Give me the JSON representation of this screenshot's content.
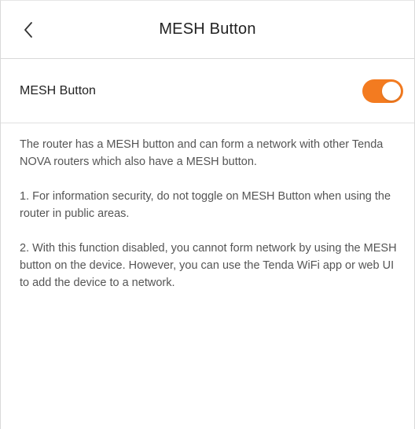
{
  "header": {
    "title": "MESH Button",
    "back_icon": "chevron-left-icon"
  },
  "setting": {
    "label": "MESH Button",
    "toggle_state": "on",
    "accent_color": "#f37b20"
  },
  "description": {
    "paragraphs": [
      "The router has a MESH button and can form a network with other Tenda NOVA routers which also have a MESH button.",
      "1. For information security, do not toggle on MESH Button when using the router in public areas.",
      "2. With this function disabled, you cannot form network by using the MESH button on the device. However, you can use the Tenda WiFi app or web UI to add the device to a network."
    ]
  }
}
